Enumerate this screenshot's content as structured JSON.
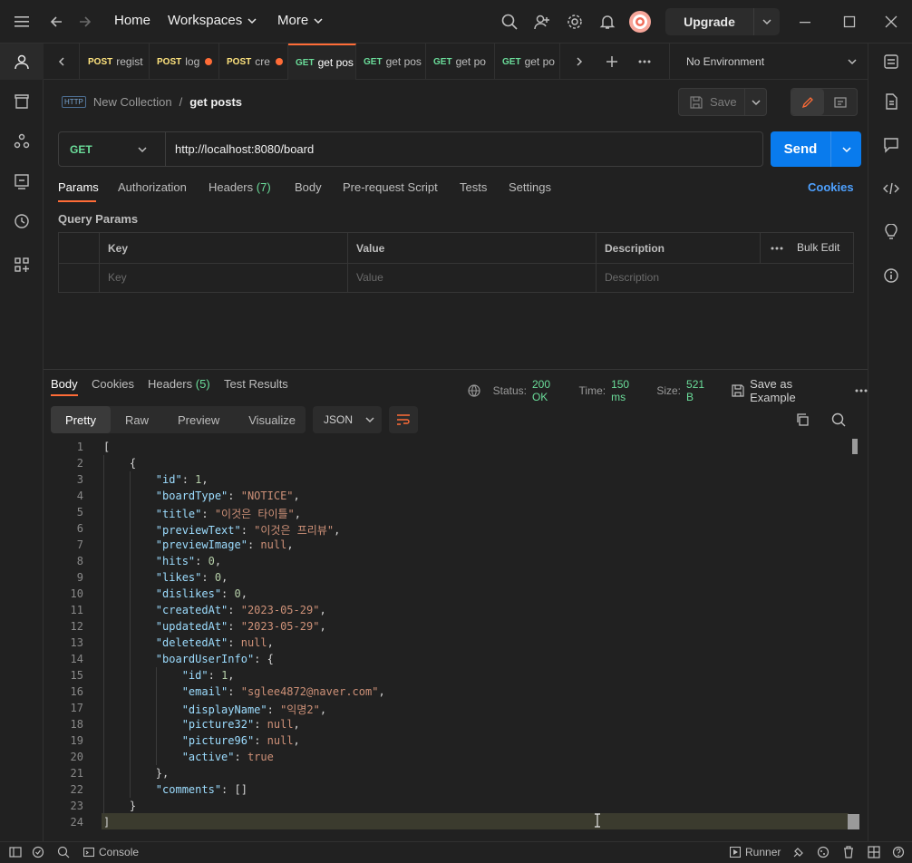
{
  "topbar": {
    "home": "Home",
    "workspaces": "Workspaces",
    "more": "More",
    "upgrade": "Upgrade"
  },
  "tabs": [
    {
      "method": "POST",
      "name": "regist",
      "color": "#ffe47e",
      "dirty": false
    },
    {
      "method": "POST",
      "name": "log",
      "color": "#ffe47e",
      "dirty": true
    },
    {
      "method": "POST",
      "name": "cre",
      "color": "#ffe47e",
      "dirty": true
    },
    {
      "method": "GET",
      "name": "get pos",
      "color": "#6bdd9a",
      "dirty": false,
      "active": true
    },
    {
      "method": "GET",
      "name": "get pos",
      "color": "#6bdd9a",
      "dirty": false
    },
    {
      "method": "GET",
      "name": "get po",
      "color": "#6bdd9a",
      "dirty": false
    },
    {
      "method": "GET",
      "name": "get po",
      "color": "#6bdd9a",
      "dirty": false
    }
  ],
  "environment": "No Environment",
  "breadcrumb": {
    "collection": "New Collection",
    "separator": "/",
    "request": "get posts",
    "badge": "HTTP"
  },
  "save_label": "Save",
  "request": {
    "method": "GET",
    "url": "http://localhost:8080/board",
    "send": "Send",
    "tabs": {
      "params": "Params",
      "authorization": "Authorization",
      "headers": "Headers",
      "headers_count": "(7)",
      "body": "Body",
      "prerequest": "Pre-request Script",
      "tests": "Tests",
      "settings": "Settings",
      "cookies": "Cookies"
    },
    "query_params_title": "Query Params",
    "columns": {
      "key": "Key",
      "value": "Value",
      "description": "Description",
      "bulk_edit": "Bulk Edit"
    },
    "placeholders": {
      "key": "Key",
      "value": "Value",
      "description": "Description"
    }
  },
  "response": {
    "tabs": {
      "body": "Body",
      "cookies": "Cookies",
      "headers": "Headers",
      "headers_count": "(5)",
      "test_results": "Test Results"
    },
    "status_label": "Status:",
    "status_value": "200 OK",
    "time_label": "Time:",
    "time_value": "150 ms",
    "size_label": "Size:",
    "size_value": "521 B",
    "save_example": "Save as Example",
    "formats": [
      "Pretty",
      "Raw",
      "Preview",
      "Visualize"
    ],
    "language": "JSON"
  },
  "code_lines": [
    [
      [
        "p",
        "["
      ]
    ],
    [
      [
        "p",
        "    {"
      ]
    ],
    [
      [
        "p",
        "        "
      ],
      [
        "k",
        "\"id\""
      ],
      [
        "p",
        ": "
      ],
      [
        "n",
        "1"
      ],
      [
        "p",
        ","
      ]
    ],
    [
      [
        "p",
        "        "
      ],
      [
        "k",
        "\"boardType\""
      ],
      [
        "p",
        ": "
      ],
      [
        "s",
        "\"NOTICE\""
      ],
      [
        "p",
        ","
      ]
    ],
    [
      [
        "p",
        "        "
      ],
      [
        "k",
        "\"title\""
      ],
      [
        "p",
        ": "
      ],
      [
        "s",
        "\"이것은 타이틀\""
      ],
      [
        "p",
        ","
      ]
    ],
    [
      [
        "p",
        "        "
      ],
      [
        "k",
        "\"previewText\""
      ],
      [
        "p",
        ": "
      ],
      [
        "s",
        "\"이것은 프리뷰\""
      ],
      [
        "p",
        ","
      ]
    ],
    [
      [
        "p",
        "        "
      ],
      [
        "k",
        "\"previewImage\""
      ],
      [
        "p",
        ": "
      ],
      [
        "b",
        "null"
      ],
      [
        "p",
        ","
      ]
    ],
    [
      [
        "p",
        "        "
      ],
      [
        "k",
        "\"hits\""
      ],
      [
        "p",
        ": "
      ],
      [
        "n",
        "0"
      ],
      [
        "p",
        ","
      ]
    ],
    [
      [
        "p",
        "        "
      ],
      [
        "k",
        "\"likes\""
      ],
      [
        "p",
        ": "
      ],
      [
        "n",
        "0"
      ],
      [
        "p",
        ","
      ]
    ],
    [
      [
        "p",
        "        "
      ],
      [
        "k",
        "\"dislikes\""
      ],
      [
        "p",
        ": "
      ],
      [
        "n",
        "0"
      ],
      [
        "p",
        ","
      ]
    ],
    [
      [
        "p",
        "        "
      ],
      [
        "k",
        "\"createdAt\""
      ],
      [
        "p",
        ": "
      ],
      [
        "s",
        "\"2023-05-29\""
      ],
      [
        "p",
        ","
      ]
    ],
    [
      [
        "p",
        "        "
      ],
      [
        "k",
        "\"updatedAt\""
      ],
      [
        "p",
        ": "
      ],
      [
        "s",
        "\"2023-05-29\""
      ],
      [
        "p",
        ","
      ]
    ],
    [
      [
        "p",
        "        "
      ],
      [
        "k",
        "\"deletedAt\""
      ],
      [
        "p",
        ": "
      ],
      [
        "b",
        "null"
      ],
      [
        "p",
        ","
      ]
    ],
    [
      [
        "p",
        "        "
      ],
      [
        "k",
        "\"boardUserInfo\""
      ],
      [
        "p",
        ": {"
      ]
    ],
    [
      [
        "p",
        "            "
      ],
      [
        "k",
        "\"id\""
      ],
      [
        "p",
        ": "
      ],
      [
        "n",
        "1"
      ],
      [
        "p",
        ","
      ]
    ],
    [
      [
        "p",
        "            "
      ],
      [
        "k",
        "\"email\""
      ],
      [
        "p",
        ": "
      ],
      [
        "s",
        "\"sglee4872@naver.com\""
      ],
      [
        "p",
        ","
      ]
    ],
    [
      [
        "p",
        "            "
      ],
      [
        "k",
        "\"displayName\""
      ],
      [
        "p",
        ": "
      ],
      [
        "s",
        "\"익명2\""
      ],
      [
        "p",
        ","
      ]
    ],
    [
      [
        "p",
        "            "
      ],
      [
        "k",
        "\"picture32\""
      ],
      [
        "p",
        ": "
      ],
      [
        "b",
        "null"
      ],
      [
        "p",
        ","
      ]
    ],
    [
      [
        "p",
        "            "
      ],
      [
        "k",
        "\"picture96\""
      ],
      [
        "p",
        ": "
      ],
      [
        "b",
        "null"
      ],
      [
        "p",
        ","
      ]
    ],
    [
      [
        "p",
        "            "
      ],
      [
        "k",
        "\"active\""
      ],
      [
        "p",
        ": "
      ],
      [
        "b",
        "true"
      ]
    ],
    [
      [
        "p",
        "        },"
      ]
    ],
    [
      [
        "p",
        "        "
      ],
      [
        "k",
        "\"comments\""
      ],
      [
        "p",
        ": []"
      ]
    ],
    [
      [
        "p",
        "    }"
      ]
    ],
    [
      [
        "p",
        "]"
      ]
    ]
  ],
  "statusbar": {
    "console": "Console",
    "runner": "Runner"
  }
}
